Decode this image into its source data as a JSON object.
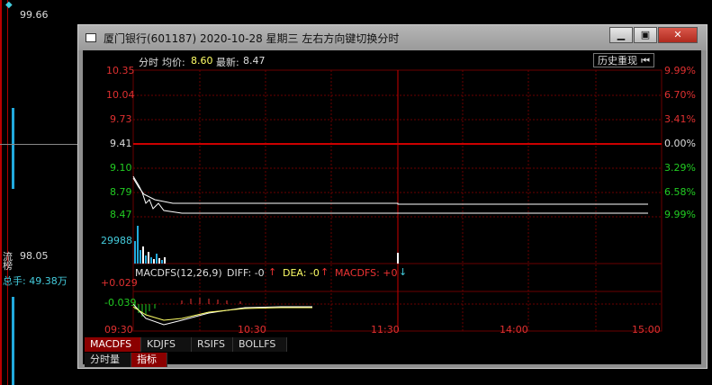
{
  "background": {
    "left_price_top": "99.66",
    "left_price_mid": "98.05",
    "left_label_a": "流",
    "left_label_b": "榜",
    "left_total_hand": "总手: 49.38万"
  },
  "window": {
    "title": "厦门银行(601187) 2020-10-28 星期三      左右方向键切换分时",
    "minimize_label": "▁",
    "restore_label": "▣",
    "close_label": "✕"
  },
  "chart": {
    "header_prefix": "分时",
    "avg_label": "均价:",
    "avg_value": "8.60",
    "latest_label": "最新:",
    "latest_value": "8.47",
    "history_button": "历史重现",
    "price_labels": [
      "10.35",
      "10.04",
      "9.73",
      "9.41",
      "9.10",
      "8.79",
      "8.47"
    ],
    "pct_labels": [
      "9.99%",
      "6.70%",
      "3.41%",
      "0.00%",
      "3.29%",
      "6.58%",
      "9.99%"
    ],
    "volume_label": "29988",
    "macd_name": "MACDFS(12,26,9)",
    "macd_diff": "DIFF: -0",
    "macd_dea": "DEA: -0",
    "macd_val": "MACDFS: +0",
    "macd_upper": "+0.029",
    "macd_lower": "-0.039",
    "time_labels": [
      "09:30",
      "10:30",
      "11:30",
      "14:00",
      "15:00"
    ],
    "colors": {
      "up": "#e03030",
      "down": "#22cc22",
      "grid": "#7a0000",
      "price_line": "#ffffff",
      "avg_line": "#ffff66"
    }
  },
  "chart_data": {
    "type": "line",
    "x_labels": [
      "09:30",
      "10:30",
      "11:30",
      "14:00",
      "15:00"
    ],
    "ylim": [
      8.47,
      10.35
    ],
    "series": [
      {
        "name": "最新",
        "values": [
          8.79,
          8.65,
          8.55,
          8.5,
          8.48,
          8.47,
          8.47,
          8.47
        ]
      },
      {
        "name": "均价",
        "values": [
          8.75,
          8.68,
          8.63,
          8.61,
          8.6,
          8.6,
          8.6,
          8.6
        ]
      }
    ]
  },
  "tabs": {
    "indicators": [
      "MACDFS",
      "KDJFS",
      "RSIFS",
      "BOLLFS"
    ],
    "bottom": [
      "分时量",
      "指标"
    ]
  }
}
